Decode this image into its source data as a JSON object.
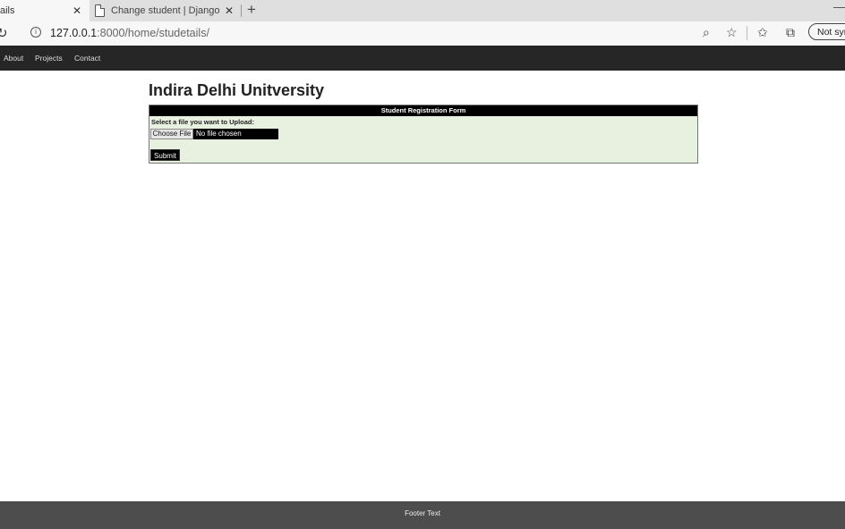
{
  "browser": {
    "tabs": [
      {
        "title": "ails",
        "active": true
      },
      {
        "title": "Change student | Django site ad",
        "active": false
      }
    ],
    "address": {
      "host": "127.0.0.1",
      "path": ":8000/home/studetails/"
    },
    "sync_button": "Not sync"
  },
  "icons": {
    "reload": "reload-icon",
    "info": "info-icon",
    "zoom": "zoom-icon",
    "star": "favorite-star-icon",
    "favorites": "favorites-list-icon",
    "collections": "collections-icon",
    "page": "page-icon",
    "close": "close-icon",
    "new_tab": "new-tab-icon",
    "minimize": "minimize-icon"
  },
  "site": {
    "nav": [
      "About",
      "Projects",
      "Contact"
    ],
    "title": "Indira Delhi Unitversity",
    "form": {
      "header": "Student Registration Form",
      "label": "Select a file you want to Upload:",
      "choose_button": "Choose File",
      "file_status": "No file chosen",
      "submit": "Submit"
    },
    "footer": "Footer Text"
  },
  "colors": {
    "nav_bg": "#262626",
    "form_bg": "#e8f0e0",
    "footer_bg": "#4d4d4d"
  }
}
